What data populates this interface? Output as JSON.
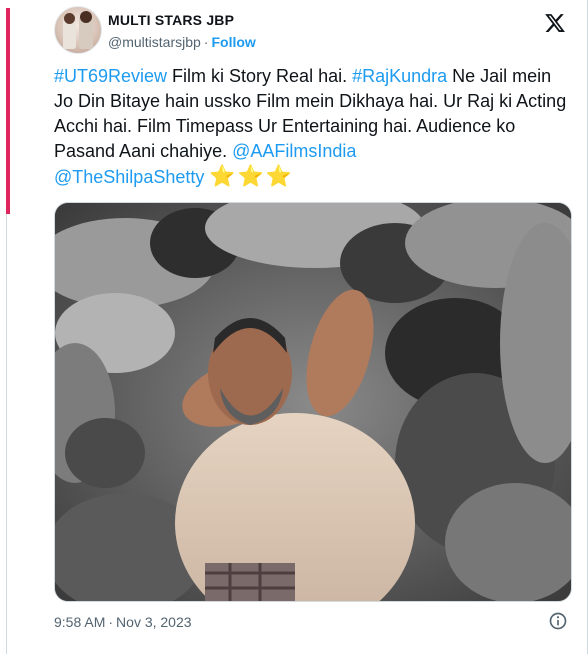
{
  "author": {
    "name": "MULTI STARS JBP",
    "handle": "@multistarsjbp",
    "separator": "·",
    "follow_label": "Follow",
    "avatar": "avatar-photo-two-women"
  },
  "brand_icon": "x-logo-icon",
  "tweet": {
    "hashtag1": "#UT69Review",
    "text1": " Film ki Story Real hai. ",
    "hashtag2": "#RajKundra",
    "text2": " Ne Jail mein Jo Din Bitaye hain ussko Film mein Dikhaya hai. Ur Raj ki Acting Acchi hai. Film Timepass Ur Entertaining hai. Audience ko Pasand Aani chahiye. ",
    "mention1": "@AAFilmsIndia",
    "mention2": "@TheShilpaShetty",
    "stars": "⭐⭐⭐"
  },
  "media": {
    "description_icon": "movie-still-image"
  },
  "footer": {
    "time": "9:58 AM",
    "separator": "·",
    "date": "Nov 3, 2023",
    "info_icon": "info-icon"
  },
  "colors": {
    "link": "#1d9bf0",
    "accent_bar": "#e0245e",
    "secondary_text": "#536471",
    "primary_text": "#0f1419"
  }
}
